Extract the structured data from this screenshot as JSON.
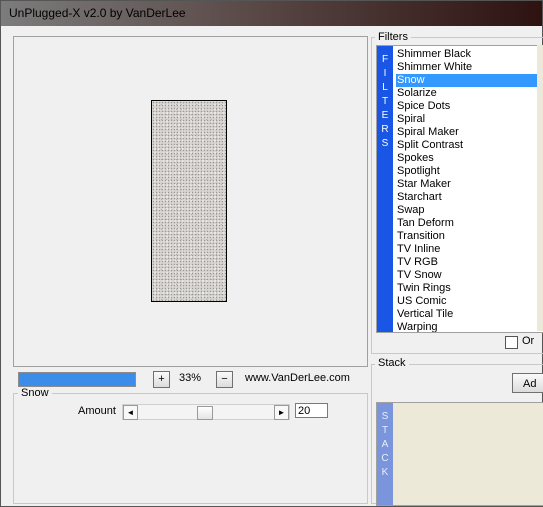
{
  "window": {
    "title": "UnPlugged-X v2.0 by VanDerLee"
  },
  "toolbar": {
    "zoom_in_label": "+",
    "zoom_value": "33%",
    "zoom_out_label": "−",
    "website": "www.VanDerLee.com",
    "progress": 1.0
  },
  "params": {
    "group_label": "Snow",
    "amount_label": "Amount",
    "amount_value": "20",
    "amount_fraction": 0.48,
    "left_arrow": "◄",
    "right_arrow": "►"
  },
  "filters": {
    "group_label": "Filters",
    "side_label": [
      "F",
      "I",
      "L",
      "T",
      "E",
      "R",
      "S"
    ],
    "items": [
      "Shimmer Black",
      "Shimmer White",
      "Snow",
      "Solarize",
      "Spice Dots",
      "Spiral",
      "Spiral Maker",
      "Split Contrast",
      "Spokes",
      "Spotlight",
      "Star Maker",
      "Starchart",
      "Swap",
      "Tan Deform",
      "Transition",
      "TV Inline",
      "TV RGB",
      "TV Snow",
      "Twin Rings",
      "US Comic",
      "Vertical Tile",
      "Warping"
    ],
    "selected": "Snow",
    "option_label": "Or"
  },
  "stack": {
    "group_label": "Stack",
    "add_label": "Ad",
    "side_label": [
      "S",
      "T",
      "A",
      "C",
      "K"
    ]
  },
  "colors": {
    "accent": "#1a56e6",
    "selection": "#3399ff",
    "progress": "#3c8cea"
  }
}
